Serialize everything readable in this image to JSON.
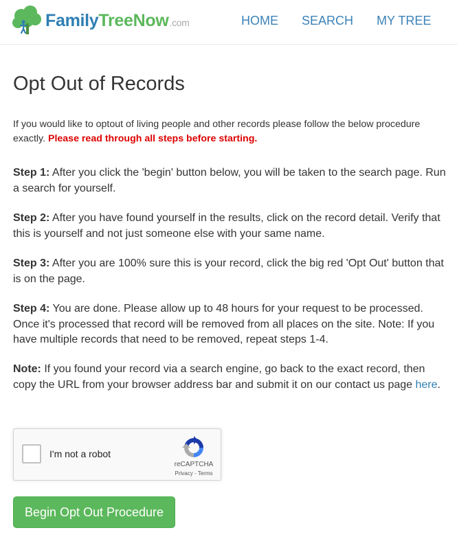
{
  "header": {
    "brand_part1": "Family",
    "brand_part2": "TreeNow",
    "brand_suffix": ".com",
    "nav": [
      {
        "label": "HOME"
      },
      {
        "label": "SEARCH"
      },
      {
        "label": "MY TREE"
      }
    ]
  },
  "main": {
    "title": "Opt Out of Records",
    "intro_text": "If you would like to optout of living people and other records please follow the below procedure exactly.",
    "intro_warning": "Please read through all steps before starting.",
    "steps": [
      {
        "label": "Step 1:",
        "text": "After you click the 'begin' button below, you will be taken to the search page. Run a search for yourself."
      },
      {
        "label": "Step 2:",
        "text": "After you have found yourself in the results, click on the record detail. Verify that this is yourself and not just someone else with your same name."
      },
      {
        "label": "Step 3:",
        "text": "After you are 100% sure this is your record, click the big red 'Opt Out' button that is on the page."
      },
      {
        "label": "Step 4:",
        "text": "You are done. Please allow up to 48 hours for your request to be processed. Once it's processed that record will be removed from all places on the site. Note: If you have multiple records that need to be removed, repeat steps 1-4."
      }
    ],
    "note_label": "Note:",
    "note_text": "If you found your record via a search engine, go back to the exact record, then copy the URL from your browser address bar and submit it on our contact us page",
    "note_link": "here",
    "note_end": "."
  },
  "recaptcha": {
    "label": "I'm not a robot",
    "brand": "reCAPTCHA",
    "privacy": "Privacy",
    "separator": " - ",
    "terms": "Terms",
    "checked": false
  },
  "begin_button": {
    "label": "Begin Opt Out Procedure"
  },
  "colors": {
    "brand_blue": "#2f7fb4",
    "brand_green": "#5cb85c",
    "nav_link": "#3b82b8",
    "warning_red": "#dd0000",
    "button_green": "#5cb85c"
  }
}
